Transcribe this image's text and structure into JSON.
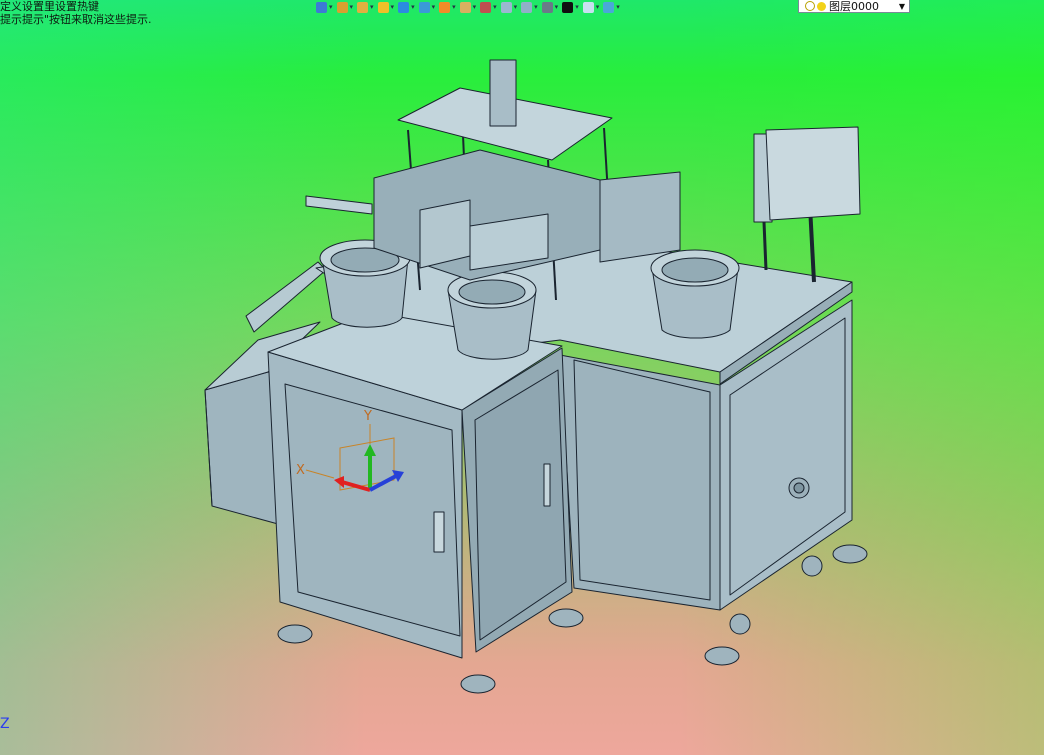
{
  "status": {
    "hint_line1": "定义设置里设置热键",
    "hint_line2": "提示提示\"按钮来取消这些提示."
  },
  "toolbar": {
    "items": [
      {
        "icon": "undo-icon",
        "color": "#3d7bd6"
      },
      {
        "icon": "model-tree-icon",
        "color": "#d8a030"
      },
      {
        "icon": "pencil-icon",
        "color": "#e0b040"
      },
      {
        "icon": "box-solid-icon",
        "color": "#f0c028"
      },
      {
        "icon": "cube-blue-icon",
        "color": "#2b8be0"
      },
      {
        "icon": "cube-stack-icon",
        "color": "#3a9ad8"
      },
      {
        "icon": "render-ball-icon",
        "color": "#f08c28"
      },
      {
        "icon": "measure-icon",
        "color": "#d8b060"
      },
      {
        "icon": "move-axis-icon",
        "color": "#c05050"
      },
      {
        "icon": "page-icon",
        "color": "#9ab8d0"
      },
      {
        "icon": "page-2-icon",
        "color": "#90b0c8"
      },
      {
        "icon": "monitor-icon",
        "color": "#6a7a88"
      },
      {
        "icon": "line-style-icon",
        "color": "#101010"
      },
      {
        "icon": "color-swatch-icon",
        "color": "#c8e0f0"
      },
      {
        "icon": "layers-icon",
        "color": "#4aa8d8"
      }
    ],
    "layer_label": "图层0000"
  },
  "triad": {
    "x_label": "X",
    "y_label": "Y"
  },
  "corner_axis_label": "Z",
  "colors": {
    "machine_fill": "#a7bcc6",
    "machine_dark": "#8ea6b1",
    "machine_light": "#bcd0d8",
    "outline": "#1a2430"
  }
}
